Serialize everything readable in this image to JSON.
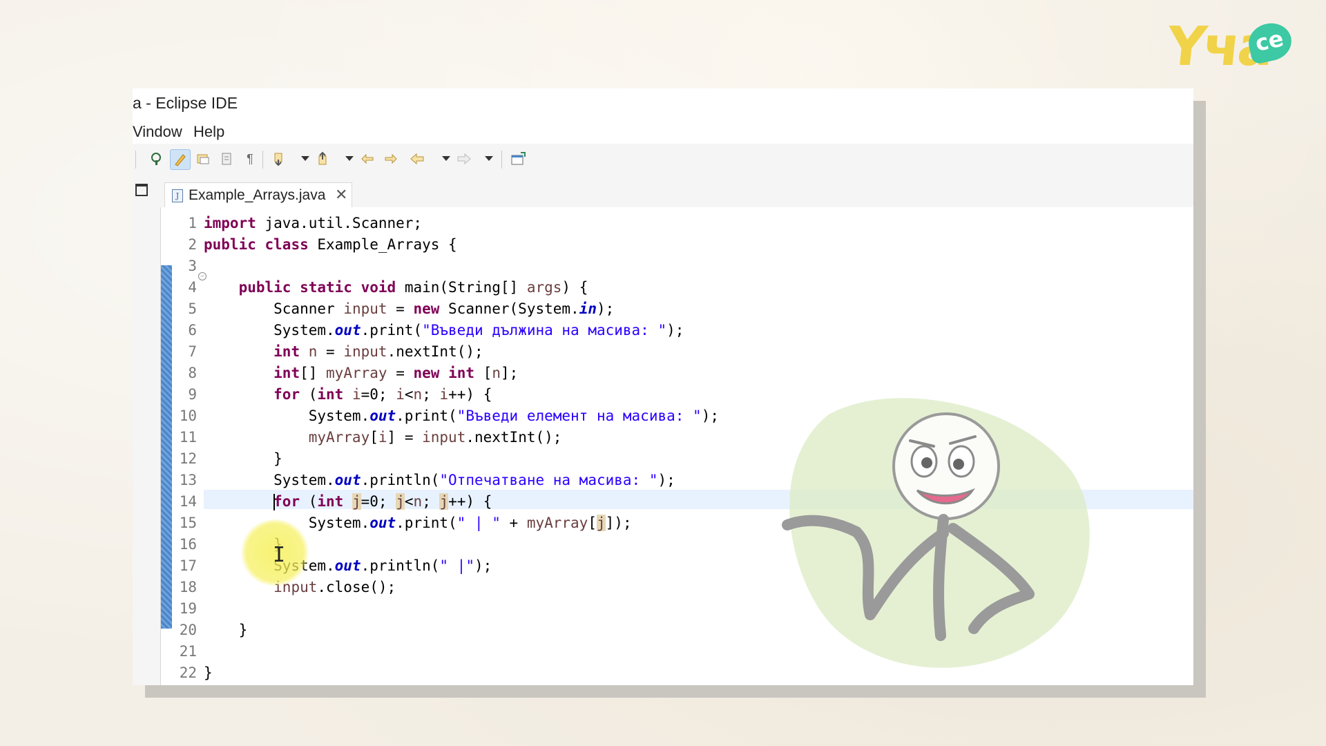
{
  "window": {
    "title": "a - Eclipse IDE"
  },
  "menu": {
    "items": [
      "Vindow",
      "Help"
    ]
  },
  "toolbar": {
    "icons": [
      "external-tools-icon",
      "mark-occurrences-icon",
      "toggle-breadcrumb-icon",
      "block-selection-icon",
      "show-whitespace-icon",
      "next-annotation-icon",
      "prev-annotation-icon",
      "last-edit-icon",
      "back-icon",
      "forward-icon",
      "open-perspective-icon"
    ]
  },
  "editor": {
    "tab_label": "Example_Arrays.java",
    "tab_close": "✕",
    "line_numbers": [
      "1",
      "2",
      "3",
      "4",
      "5",
      "6",
      "7",
      "8",
      "9",
      "10",
      "11",
      "12",
      "13",
      "14",
      "15",
      "16",
      "17",
      "18",
      "19",
      "20",
      "21",
      "22"
    ],
    "code_lines": [
      "import java.util.Scanner;",
      "public class Example_Arrays {",
      "",
      "    public static void main(String[] args) {",
      "        Scanner input = new Scanner(System.in);",
      "        System.out.print(\"Въведи дължина на масива: \");",
      "        int n = input.nextInt();",
      "        int[] myArray = new int [n];",
      "        for (int i=0; i<n; i++) {",
      "            System.out.print(\"Въведи елемент на масива: \");",
      "            myArray[i] = input.nextInt();",
      "        }",
      "        System.out.println(\"Отпечатване на масива: \");",
      "        for (int j=0; j<n; j++) {",
      "            System.out.print(\" | \" + myArray[j]);",
      "        }",
      "        System.out.println(\" |\");",
      "        input.close();",
      "",
      "    }",
      "",
      "}"
    ],
    "current_line": "14"
  },
  "brand": {
    "logo_text": "Yчa",
    "logo_bubble": "ce",
    "accent": "#f1d34a",
    "bubble_color": "#3cc9a3"
  }
}
